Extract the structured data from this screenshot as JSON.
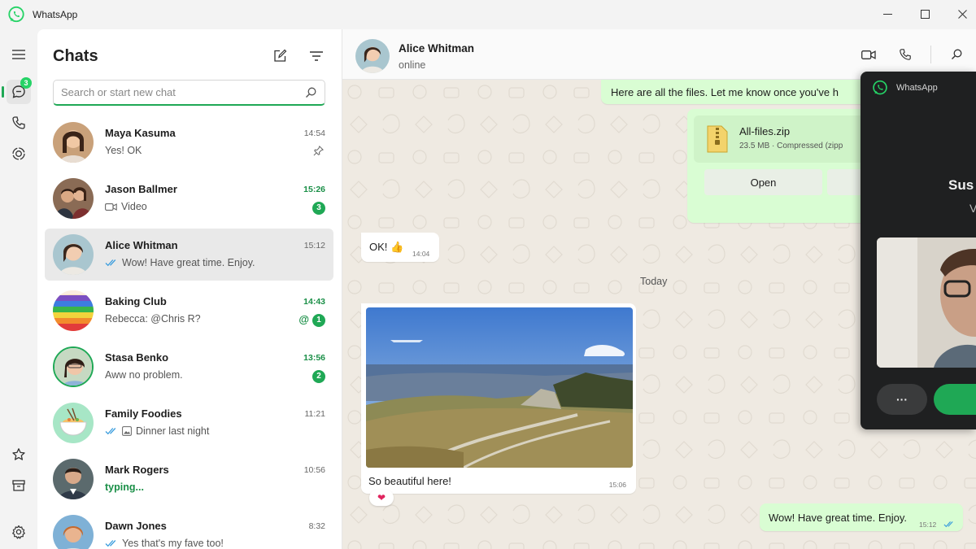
{
  "window": {
    "title": "WhatsApp"
  },
  "rail": {
    "chats_badge": "3"
  },
  "chat_list": {
    "title": "Chats",
    "search_placeholder": "Search or start new chat",
    "items": [
      {
        "name": "Maya Kasuma",
        "time": "14:54",
        "preview": "Yes! OK",
        "pinned": true
      },
      {
        "name": "Jason Ballmer",
        "time": "15:26",
        "preview": "Video",
        "unread": "3"
      },
      {
        "name": "Alice Whitman",
        "time": "15:12",
        "preview": "Wow! Have great time. Enjoy.",
        "selected": true
      },
      {
        "name": "Baking Club",
        "time": "14:43",
        "preview": "Rebecca: @Chris R?",
        "mention": "@",
        "unread": "1"
      },
      {
        "name": "Stasa Benko",
        "time": "13:56",
        "preview": "Aww no problem.",
        "unread": "2"
      },
      {
        "name": "Family Foodies",
        "time": "11:21",
        "preview": "Dinner last night"
      },
      {
        "name": "Mark Rogers",
        "time": "10:56",
        "preview": "typing..."
      },
      {
        "name": "Dawn Jones",
        "time": "8:32",
        "preview": "Yes that's my fave too!"
      }
    ]
  },
  "conversation": {
    "contact_name": "Alice Whitman",
    "contact_status": "online",
    "messages": {
      "files_text": "Here are all the files. Let me know once you've h",
      "file_name": "All-files.zip",
      "file_meta": "23.5 MB · Compressed (zipp",
      "file_open": "Open",
      "ok_text": "OK! 👍",
      "ok_time": "14:04",
      "date_separator": "Today",
      "photo_caption": "So beautiful here!",
      "photo_time": "15:06",
      "photo_reaction": "❤",
      "last_text": "Wow! Have great time. Enjoy.",
      "last_time": "15:12"
    }
  },
  "call_window": {
    "title": "WhatsApp",
    "caller_name": "Sus",
    "caller_sub": "V",
    "more_label": "···"
  },
  "colors": {
    "accent": "#1fa855",
    "outgoing_bubble": "#d9fdd3",
    "chat_bg": "#efeae2"
  }
}
